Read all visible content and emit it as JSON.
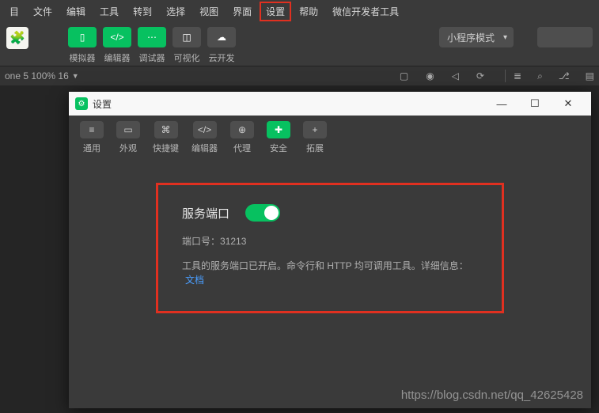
{
  "menubar": {
    "items": [
      "目",
      "文件",
      "编辑",
      "工具",
      "转到",
      "选择",
      "视图",
      "界面",
      "设置",
      "帮助",
      "微信开发者工具"
    ],
    "highlighted_index": 8
  },
  "toolbar": {
    "items": [
      {
        "label": "模拟器",
        "icon": "phone"
      },
      {
        "label": "编辑器",
        "icon": "code"
      },
      {
        "label": "调试器",
        "icon": "bug"
      },
      {
        "label": "可视化",
        "icon": "visual",
        "grey": true
      },
      {
        "label": "云开发",
        "icon": "cloud",
        "grey": true
      }
    ],
    "mode": "小程序模式",
    "compile": ""
  },
  "statusbar": {
    "device": "one 5 100% 16",
    "icons": [
      "phone",
      "record",
      "send",
      "refresh"
    ],
    "page_icons": [
      "list",
      "search",
      "branch",
      "panel"
    ]
  },
  "settings_window": {
    "title": "设置",
    "tabs": [
      {
        "label": "通用",
        "icon": "≡"
      },
      {
        "label": "外观",
        "icon": "▭"
      },
      {
        "label": "快捷键",
        "icon": "⌘"
      },
      {
        "label": "编辑器",
        "icon": "</>"
      },
      {
        "label": "代理",
        "icon": "⊕"
      },
      {
        "label": "安全",
        "icon": "✚",
        "active": true
      },
      {
        "label": "拓展",
        "icon": "+"
      }
    ],
    "security": {
      "title": "服务端口",
      "toggle_on": true,
      "port_label": "端口号：",
      "port_value": "31213",
      "description": "工具的服务端口已开启。命令行和 HTTP 均可调用工具。详细信息：",
      "link_text": "文档"
    }
  },
  "watermark": "https://blog.csdn.net/qq_42625428"
}
